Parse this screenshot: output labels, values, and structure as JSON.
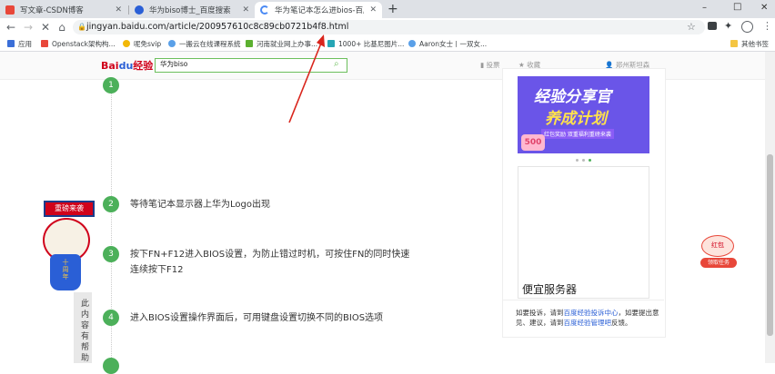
{
  "tabs": [
    {
      "title": "写文章-CSDN博客",
      "active": false,
      "favicon_color": "#e8473a"
    },
    {
      "title": "华为biso博士_百度搜索",
      "active": false,
      "favicon_color": "#2a5fd6"
    },
    {
      "title": "华为笔记本怎么进bios-百度经验",
      "active": true,
      "favicon_color": "#4a8af4"
    }
  ],
  "new_tab": "+",
  "window_controls": {
    "minimize": "–",
    "maximize": "□",
    "close": "✕"
  },
  "address": {
    "url": "jingyan.baidu.com/article/200957610c8c89cb0721b4f8.html"
  },
  "bookmarks": [
    {
      "label": "应用",
      "color": "#3b6fd8"
    },
    {
      "label": "Openstack架构构...",
      "color": "#e8473a"
    },
    {
      "label": "呢免svip",
      "color": "#f2b807"
    },
    {
      "label": "一搬云在线课程系统",
      "color": "#5aa0e8"
    },
    {
      "label": "河南就业网上办事...",
      "color": "#5cb030"
    },
    {
      "label": "1000+ 比基尼图片...",
      "color": "#27a6b5"
    },
    {
      "label": "Aaron女士丨一双女...",
      "color": "#5aa0e8"
    },
    {
      "label": "其他书签",
      "color": "#f4c542"
    }
  ],
  "site": {
    "logo_main": "Bai",
    "logo_brand": "du",
    "logo_suffix": "经验",
    "search_value": "华为biso",
    "header_links": [
      "投票",
      "收藏",
      "郑州斯坦森"
    ]
  },
  "steps": [
    {
      "num": "1",
      "text": ""
    },
    {
      "num": "2",
      "text": "等待笔记本显示器上华为Logo出现"
    },
    {
      "num": "3",
      "text": "按下FN+F12进入BIOS设置，为防止错过时机，可按住FN的同时快速连续按下F12"
    },
    {
      "num": "4",
      "text": "进入BIOS设置操作界面后，可用键盘设置切换不同的BIOS选项"
    }
  ],
  "banner": {
    "line1": "经验分享官",
    "line2": "养成计划",
    "sub": "红包奖励 双重福利重磅来袭",
    "badge": "500"
  },
  "ad": {
    "title": "便宜服务器"
  },
  "complaint": {
    "p1": "如要投诉，请到",
    "link1": "百度经验投诉中心",
    "p2": "，如要提出意见、建议，请到",
    "link2": "百度经验管理吧",
    "p3": "反馈。"
  },
  "mascot": {
    "sign": "重磅来袭",
    "belly": "十周年"
  },
  "side_text": [
    "此",
    "内",
    "容",
    "有",
    "帮",
    "助"
  ],
  "float_widget": {
    "top": "红包",
    "bottom": "领取任务"
  }
}
